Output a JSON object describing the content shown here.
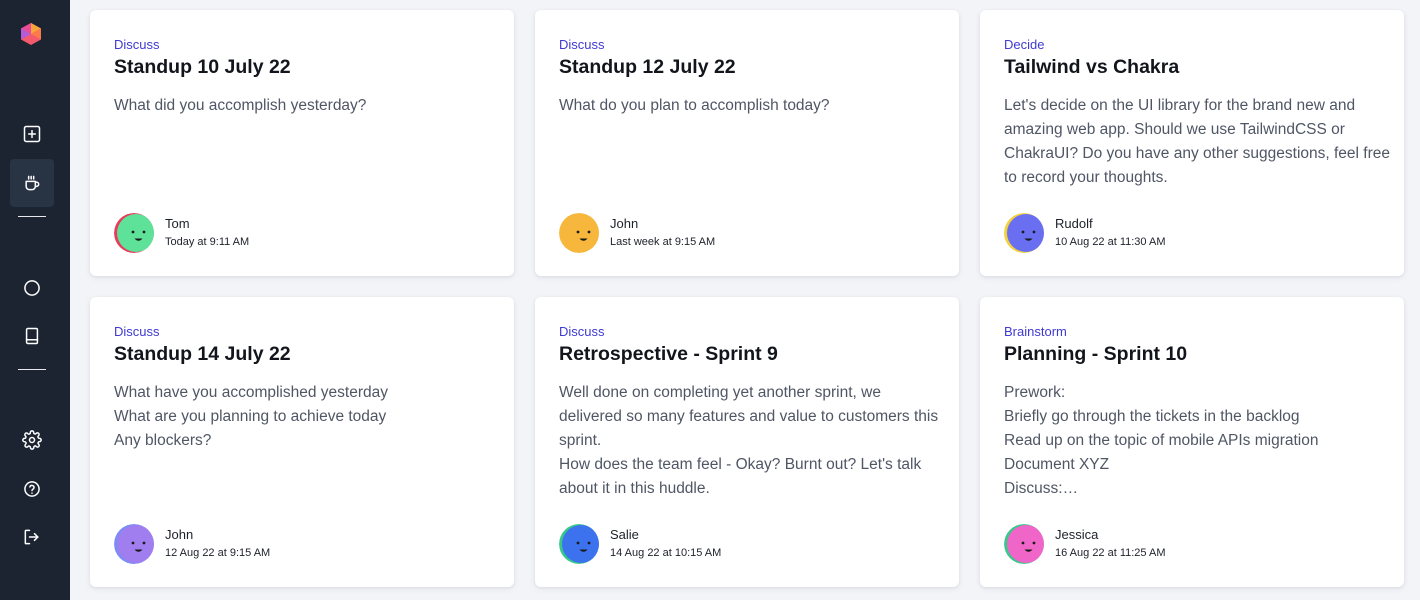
{
  "sidebar": {
    "logo": "app-logo",
    "items": [
      {
        "icon": "plus-square-icon",
        "active": false
      },
      {
        "icon": "coffee-cup-icon",
        "active": true
      },
      {
        "icon": "circle-icon",
        "active": false
      },
      {
        "icon": "book-icon",
        "active": false
      },
      {
        "icon": "gear-icon",
        "active": false
      },
      {
        "icon": "help-circle-icon",
        "active": false
      },
      {
        "icon": "logout-icon",
        "active": false
      }
    ]
  },
  "colors": {
    "sidebar_bg": "#1c2431",
    "category_text": "#3f3ad1",
    "page_bg": "#f3f4f8"
  },
  "huddles": [
    {
      "category": "Discuss",
      "title": "Standup 10 July 22",
      "description": [
        "What did you accomplish yesterday?"
      ],
      "user": {
        "name": "Tom",
        "time": "Today at 9:11 AM",
        "avatar_color": "#5ee29a",
        "edge_color": "#e83a5b"
      }
    },
    {
      "category": "Discuss",
      "title": "Standup 12 July 22",
      "description": [
        "What do you plan to accomplish today?"
      ],
      "user": {
        "name": "John",
        "time": "Last week at 9:15 AM",
        "avatar_color": "#f6b73c",
        "edge_color": "#f6b73c"
      }
    },
    {
      "category": "Decide",
      "title": "Tailwind vs Chakra",
      "description": [
        "Let's decide on the UI library for the brand new and",
        "amazing web app. Should we use TailwindCSS or",
        "ChakraUI? Do you have any other suggestions, feel free",
        "to record your thoughts."
      ],
      "user": {
        "name": "Rudolf",
        "time": "10 Aug 22 at 11:30 AM",
        "avatar_color": "#6a6ff2",
        "edge_color": "#f2d23a"
      }
    },
    {
      "category": "Discuss",
      "title": "Standup 14 July 22",
      "description": [
        "What have you accomplished yesterday",
        "What are you planning to achieve today",
        "Any blockers?"
      ],
      "user": {
        "name": "John",
        "time": "12 Aug 22 at 9:15 AM",
        "avatar_color": "#a07ef0",
        "edge_color": "#7c8cf5"
      }
    },
    {
      "category": "Discuss",
      "title": "Retrospective - Sprint 9",
      "description": [
        "Well done on completing yet another sprint, we",
        "delivered so many features and value to customers this",
        "sprint.",
        "How does the team feel - Okay? Burnt out? Let's talk",
        "about it in this huddle."
      ],
      "user": {
        "name": "Salie",
        "time": "14 Aug 22 at 10:15 AM",
        "avatar_color": "#3c72ee",
        "edge_color": "#37c98a"
      }
    },
    {
      "category": "Brainstorm",
      "title": "Planning - Sprint 10",
      "description": [
        "Prework:",
        "Briefly go through the tickets in the backlog",
        "Read up on the topic of mobile APIs migration",
        "Document XYZ",
        "Discuss:…"
      ],
      "user": {
        "name": "Jessica",
        "time": "16 Aug 22 at 11:25 AM",
        "avatar_color": "#f066c8",
        "edge_color": "#37c98a"
      }
    }
  ]
}
